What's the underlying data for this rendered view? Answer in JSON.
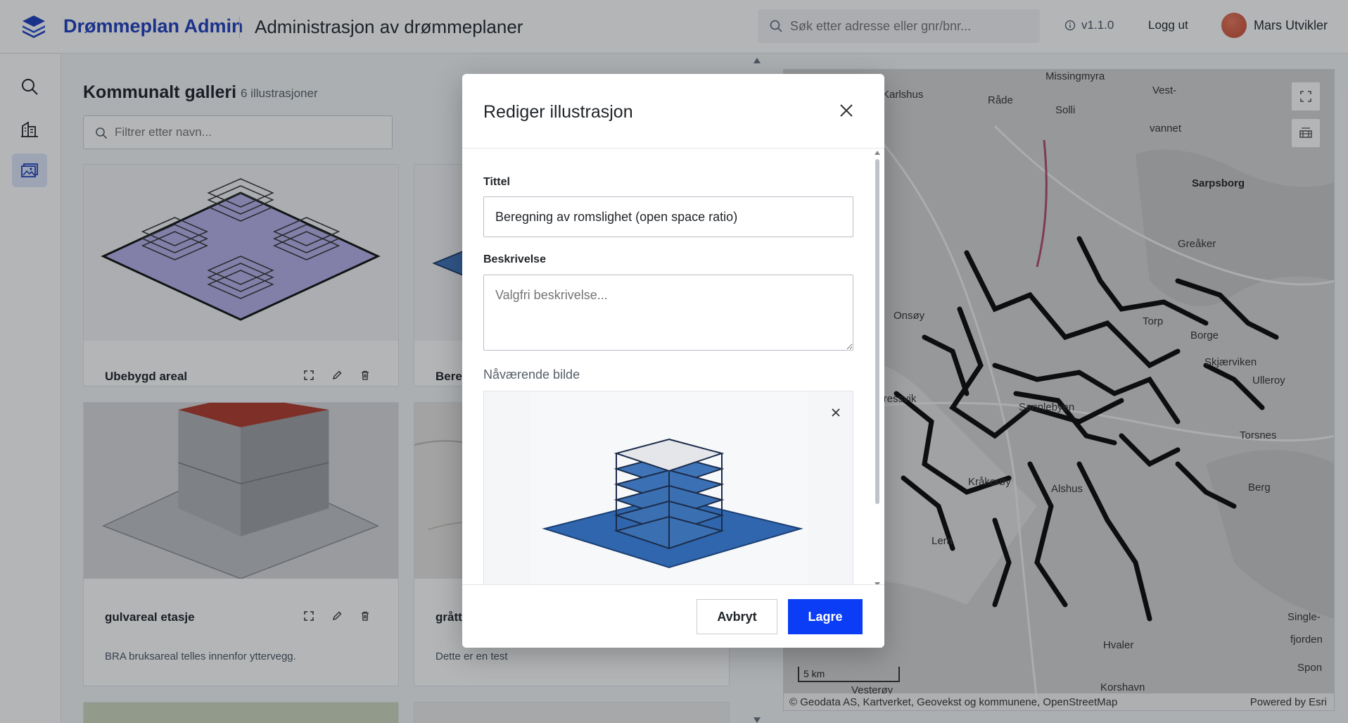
{
  "header": {
    "brand": "Drømmeplan Admin",
    "title": "Administrasjon av drømmeplaner",
    "search_placeholder": "Søk etter adresse eller gnr/bnr...",
    "version": "v1.1.0",
    "logout": "Logg ut",
    "user_name": "Mars Utvikler",
    "brand_color": "#1f3fbf"
  },
  "rail": {
    "items": [
      {
        "icon": "search-icon",
        "active": false
      },
      {
        "icon": "building-icon",
        "active": false
      },
      {
        "icon": "gallery-icon",
        "active": true
      }
    ]
  },
  "gallery": {
    "title": "Kommunalt galleri",
    "count": "6 illustrasjoner",
    "filter_placeholder": "Filtrer etter navn...",
    "cards": [
      {
        "title": "Ubebygd areal",
        "description": ""
      },
      {
        "title": "Bereg",
        "description": ""
      },
      {
        "title": "gulvareal etasje",
        "description": "BRA bruksareal telles innenfor yttervegg."
      },
      {
        "title": "grått",
        "description": "Dette er en test"
      }
    ]
  },
  "map": {
    "labels": [
      "Missingmyra",
      "Karlshus",
      "Råde",
      "Solli",
      "Vest-",
      "vannet",
      "Sarpsborg",
      "Greåker",
      "Onsøy",
      "Torp",
      "Borge",
      "Skjærviken",
      "Ulleroy",
      "Gressvik",
      "Sannlebyen",
      "Torsnes",
      "Kråkerøy",
      "Alshus",
      "Berg",
      "Lera",
      "Hvaler",
      "Single-",
      "fjorden",
      "Vesterøy",
      "Korshavn",
      "Spon",
      "Ulleroy"
    ],
    "scale": "5 km",
    "attribution": "Geodata AS, Kartverket, Geovekst og kommunene, OpenStreetMap",
    "powered": "Powered by Esri"
  },
  "modal": {
    "title": "Rediger illustrasjon",
    "title_label": "Tittel",
    "title_value": "Beregning av romslighet (open space ratio)",
    "desc_label": "Beskrivelse",
    "desc_placeholder": "Valgfri beskrivelse...",
    "current_image_label": "Nåværende bilde",
    "cancel": "Avbryt",
    "save": "Lagre",
    "accent": "#0a3df5"
  }
}
